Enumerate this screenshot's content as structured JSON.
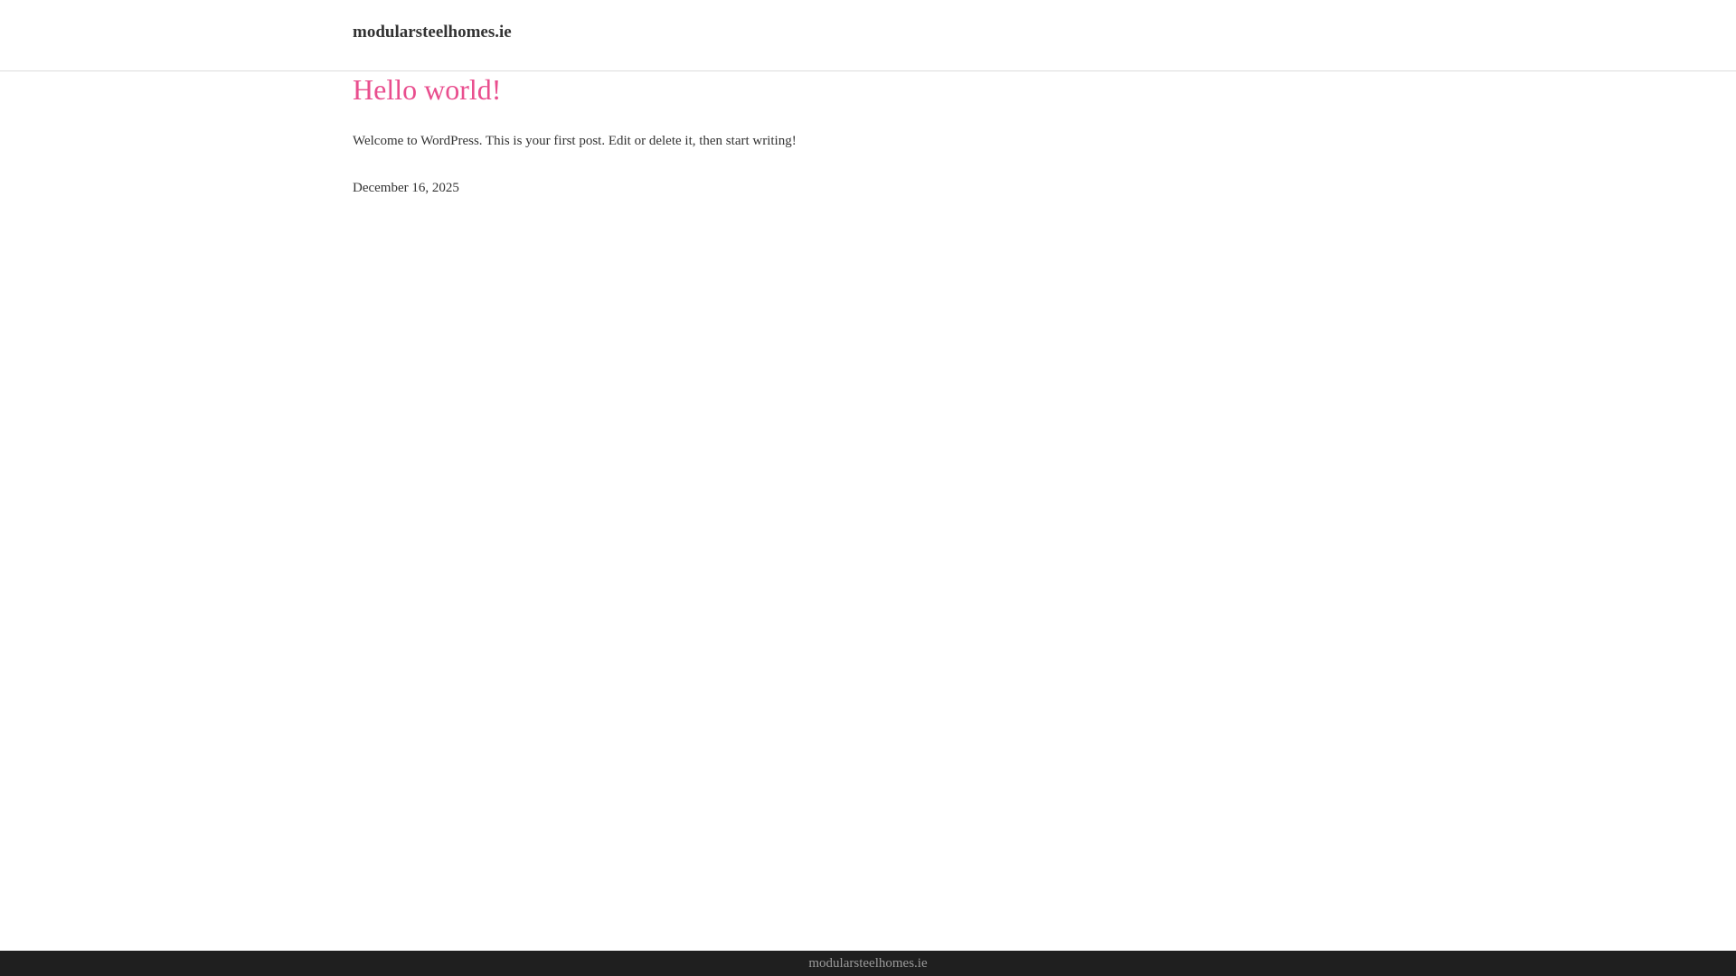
{
  "header": {
    "site_title": "modularsteelhomes.ie"
  },
  "post": {
    "title": "Hello world!",
    "excerpt": "Welcome to WordPress. This is your first post. Edit or delete it, then start writing!",
    "date": "December 16, 2025"
  },
  "footer": {
    "text": "modularsteelhomes.ie"
  },
  "colors": {
    "accent": "#e94e8e",
    "text": "#333333",
    "footer_bg": "#1f1f1f",
    "footer_text": "#9a9a9a"
  }
}
